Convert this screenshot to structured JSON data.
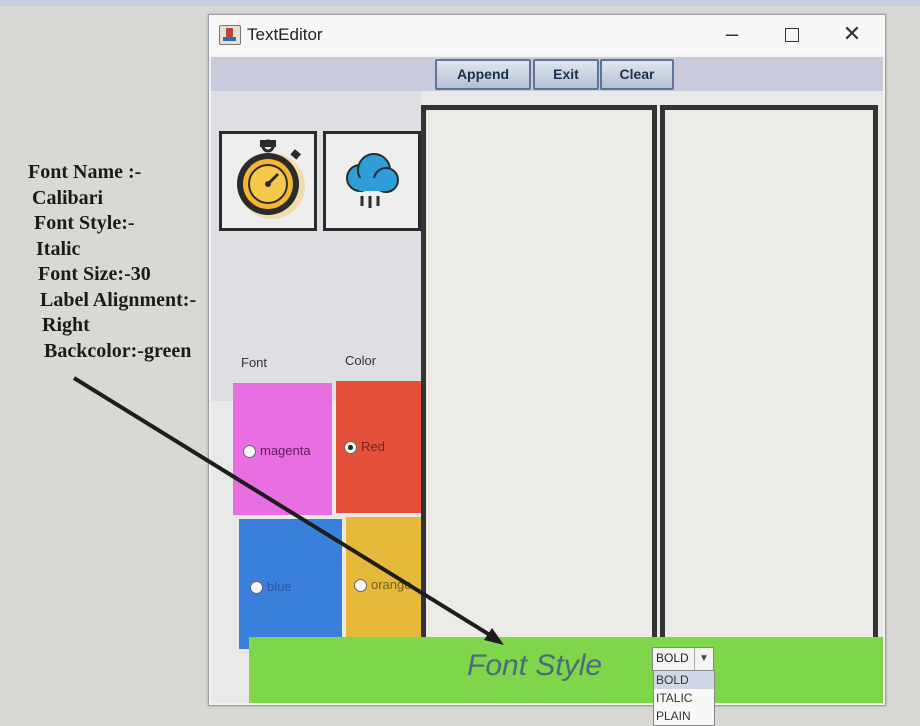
{
  "note": {
    "lines": [
      "Font Name :-",
      "Calibari",
      "Font Style:-",
      "Italic",
      "Font Size:-30",
      "Label Alignment:-",
      "Right",
      "Backcolor:-green"
    ]
  },
  "window": {
    "title": "TextEditor",
    "controls": {
      "minimize": "–",
      "close": "✕"
    }
  },
  "toolbar": {
    "append": "Append",
    "exit": "Exit",
    "clear": "Clear"
  },
  "left_panel": {
    "font_label": "Font",
    "color_label": "Color",
    "icons": [
      "stopwatch-icon",
      "cloud-rain-icon"
    ]
  },
  "colors": [
    {
      "label": "magenta",
      "selected": false,
      "bg": "#e96ee2"
    },
    {
      "label": "Red",
      "selected": true,
      "bg": "#e4503b"
    },
    {
      "label": "blue",
      "selected": false,
      "bg": "#3b7fdc"
    },
    {
      "label": "orange",
      "selected": false,
      "bg": "#e6b93a"
    }
  ],
  "status": {
    "label": "Font Style",
    "combo_value": "BOLD",
    "options": [
      "BOLD",
      "ITALIC",
      "PLAIN"
    ],
    "bg": "#7fd64a"
  }
}
